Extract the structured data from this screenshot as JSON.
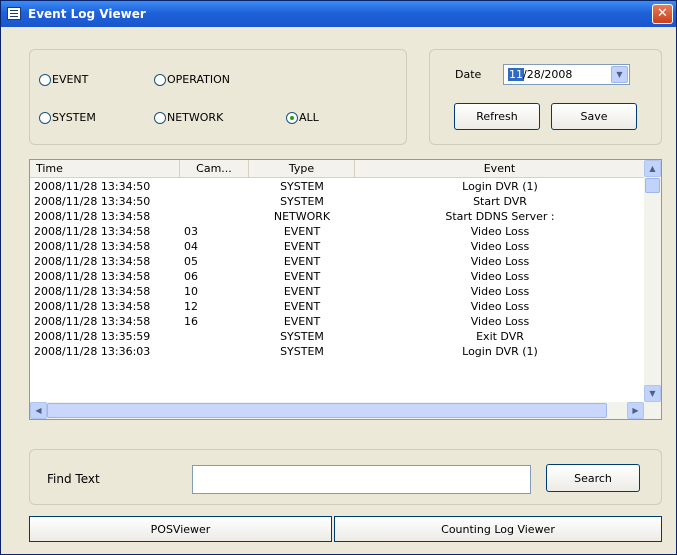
{
  "window": {
    "title": "Event Log Viewer",
    "close_glyph": "✕"
  },
  "filters": [
    {
      "label": "EVENT",
      "checked": false
    },
    {
      "label": "OPERATION",
      "checked": false
    },
    {
      "label": "SYSTEM",
      "checked": false
    },
    {
      "label": "NETWORK",
      "checked": false
    },
    {
      "label": "ALL",
      "checked": true
    }
  ],
  "date": {
    "label": "Date",
    "selected_part": "11",
    "rest": "/28/2008"
  },
  "buttons": {
    "refresh": "Refresh",
    "save": "Save",
    "search": "Search",
    "pos_viewer": "POSViewer",
    "counting_log": "Counting Log Viewer"
  },
  "table": {
    "columns": [
      "Time",
      "Cam...",
      "Type",
      "Event"
    ],
    "rows": [
      [
        "2008/11/28 13:34:50",
        "",
        "SYSTEM",
        "Login DVR (1)"
      ],
      [
        "2008/11/28 13:34:50",
        "",
        "SYSTEM",
        "Start DVR"
      ],
      [
        "2008/11/28 13:34:58",
        "",
        "NETWORK",
        "Start DDNS Server :"
      ],
      [
        "2008/11/28 13:34:58",
        "03",
        "EVENT",
        "Video Loss"
      ],
      [
        "2008/11/28 13:34:58",
        "04",
        "EVENT",
        "Video Loss"
      ],
      [
        "2008/11/28 13:34:58",
        "05",
        "EVENT",
        "Video Loss"
      ],
      [
        "2008/11/28 13:34:58",
        "06",
        "EVENT",
        "Video Loss"
      ],
      [
        "2008/11/28 13:34:58",
        "10",
        "EVENT",
        "Video Loss"
      ],
      [
        "2008/11/28 13:34:58",
        "12",
        "EVENT",
        "Video Loss"
      ],
      [
        "2008/11/28 13:34:58",
        "16",
        "EVENT",
        "Video Loss"
      ],
      [
        "2008/11/28 13:35:59",
        "",
        "SYSTEM",
        "Exit DVR"
      ],
      [
        "2008/11/28 13:36:03",
        "",
        "SYSTEM",
        "Login DVR (1)"
      ]
    ]
  },
  "find": {
    "label": "Find Text",
    "value": "",
    "placeholder": ""
  },
  "icons": {
    "window": "window-list-icon",
    "dropdown": "chevron-down-icon",
    "scroll_up": "▲",
    "scroll_down": "▼",
    "scroll_left": "◀",
    "scroll_right": "▶"
  }
}
